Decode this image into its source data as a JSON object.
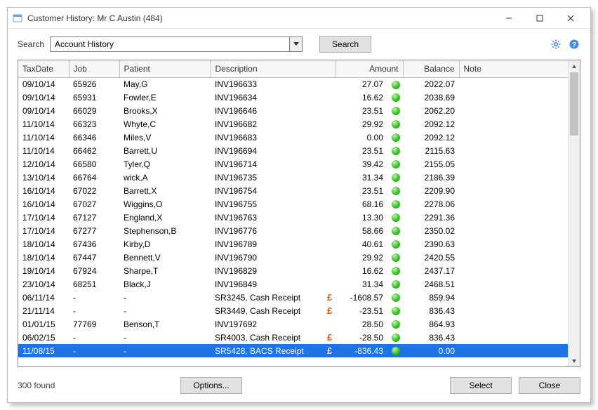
{
  "window": {
    "title": "Customer History: Mr C Austin (484)"
  },
  "toolbar": {
    "search_label": "Search",
    "combo_value": "Account History",
    "search_button": "Search"
  },
  "columns": {
    "taxdate": "TaxDate",
    "job": "Job",
    "patient": "Patient",
    "description": "Description",
    "amount": "Amount",
    "balance": "Balance",
    "note": "Note"
  },
  "rows": [
    {
      "taxdate": "09/10/14",
      "job": "65926",
      "patient": "May,G",
      "description": "INV196633",
      "pound": false,
      "amount": "27.07",
      "balance": "2022.07",
      "note": "",
      "selected": false
    },
    {
      "taxdate": "09/10/14",
      "job": "65931",
      "patient": "Fowler,E",
      "description": "INV196634",
      "pound": false,
      "amount": "16.62",
      "balance": "2038.69",
      "note": "",
      "selected": false
    },
    {
      "taxdate": "09/10/14",
      "job": "66029",
      "patient": "Brooks,X",
      "description": "INV196646",
      "pound": false,
      "amount": "23.51",
      "balance": "2062.20",
      "note": "",
      "selected": false
    },
    {
      "taxdate": "11/10/14",
      "job": "66323",
      "patient": "Whyte,C",
      "description": "INV196682",
      "pound": false,
      "amount": "29.92",
      "balance": "2092.12",
      "note": "",
      "selected": false
    },
    {
      "taxdate": "11/10/14",
      "job": "66346",
      "patient": "Miles,V",
      "description": "INV196683",
      "pound": false,
      "amount": "0.00",
      "balance": "2092.12",
      "note": "",
      "selected": false
    },
    {
      "taxdate": "11/10/14",
      "job": "66462",
      "patient": "Barrett,U",
      "description": "INV196694",
      "pound": false,
      "amount": "23.51",
      "balance": "2115.63",
      "note": "",
      "selected": false
    },
    {
      "taxdate": "12/10/14",
      "job": "66580",
      "patient": "Tyler,Q",
      "description": "INV196714",
      "pound": false,
      "amount": "39.42",
      "balance": "2155.05",
      "note": "",
      "selected": false
    },
    {
      "taxdate": "13/10/14",
      "job": "66764",
      "patient": "wick,A",
      "description": "INV196735",
      "pound": false,
      "amount": "31.34",
      "balance": "2186.39",
      "note": "",
      "selected": false
    },
    {
      "taxdate": "16/10/14",
      "job": "67022",
      "patient": "Barrett,X",
      "description": "INV196754",
      "pound": false,
      "amount": "23.51",
      "balance": "2209.90",
      "note": "",
      "selected": false
    },
    {
      "taxdate": "16/10/14",
      "job": "67027",
      "patient": "Wiggins,O",
      "description": "INV196755",
      "pound": false,
      "amount": "68.16",
      "balance": "2278.06",
      "note": "",
      "selected": false
    },
    {
      "taxdate": "17/10/14",
      "job": "67127",
      "patient": "England,X",
      "description": "INV196763",
      "pound": false,
      "amount": "13.30",
      "balance": "2291.36",
      "note": "",
      "selected": false
    },
    {
      "taxdate": "17/10/14",
      "job": "67277",
      "patient": "Stephenson,B",
      "description": "INV196776",
      "pound": false,
      "amount": "58.66",
      "balance": "2350.02",
      "note": "",
      "selected": false
    },
    {
      "taxdate": "18/10/14",
      "job": "67436",
      "patient": "Kirby,D",
      "description": "INV196789",
      "pound": false,
      "amount": "40.61",
      "balance": "2390.63",
      "note": "",
      "selected": false
    },
    {
      "taxdate": "18/10/14",
      "job": "67447",
      "patient": "Bennett,V",
      "description": "INV196790",
      "pound": false,
      "amount": "29.92",
      "balance": "2420.55",
      "note": "",
      "selected": false
    },
    {
      "taxdate": "19/10/14",
      "job": "67924",
      "patient": "Sharpe,T",
      "description": "INV196829",
      "pound": false,
      "amount": "16.62",
      "balance": "2437.17",
      "note": "",
      "selected": false
    },
    {
      "taxdate": "23/10/14",
      "job": "68251",
      "patient": "Black,J",
      "description": "INV196849",
      "pound": false,
      "amount": "31.34",
      "balance": "2468.51",
      "note": "",
      "selected": false
    },
    {
      "taxdate": "06/11/14",
      "job": "-",
      "patient": "-",
      "description": "SR3245, Cash Receipt",
      "pound": true,
      "amount": "-1608.57",
      "balance": "859.94",
      "note": "",
      "selected": false
    },
    {
      "taxdate": "21/11/14",
      "job": "-",
      "patient": "-",
      "description": "SR3449, Cash Receipt",
      "pound": true,
      "amount": "-23.51",
      "balance": "836.43",
      "note": "",
      "selected": false
    },
    {
      "taxdate": "01/01/15",
      "job": "77769",
      "patient": "Benson,T",
      "description": "INV197692",
      "pound": false,
      "amount": "28.50",
      "balance": "864.93",
      "note": "",
      "selected": false
    },
    {
      "taxdate": "06/02/15",
      "job": "-",
      "patient": "-",
      "description": "SR4003, Cash Receipt",
      "pound": true,
      "amount": "-28.50",
      "balance": "836.43",
      "note": "",
      "selected": false
    },
    {
      "taxdate": "11/08/15",
      "job": "-",
      "patient": "-",
      "description": "SR5428, BACS Receipt",
      "pound": true,
      "amount": "-836.43",
      "balance": "0.00",
      "note": "",
      "selected": true
    }
  ],
  "footer": {
    "status": "300  found",
    "options": "Options...",
    "select": "Select",
    "close": "Close"
  }
}
